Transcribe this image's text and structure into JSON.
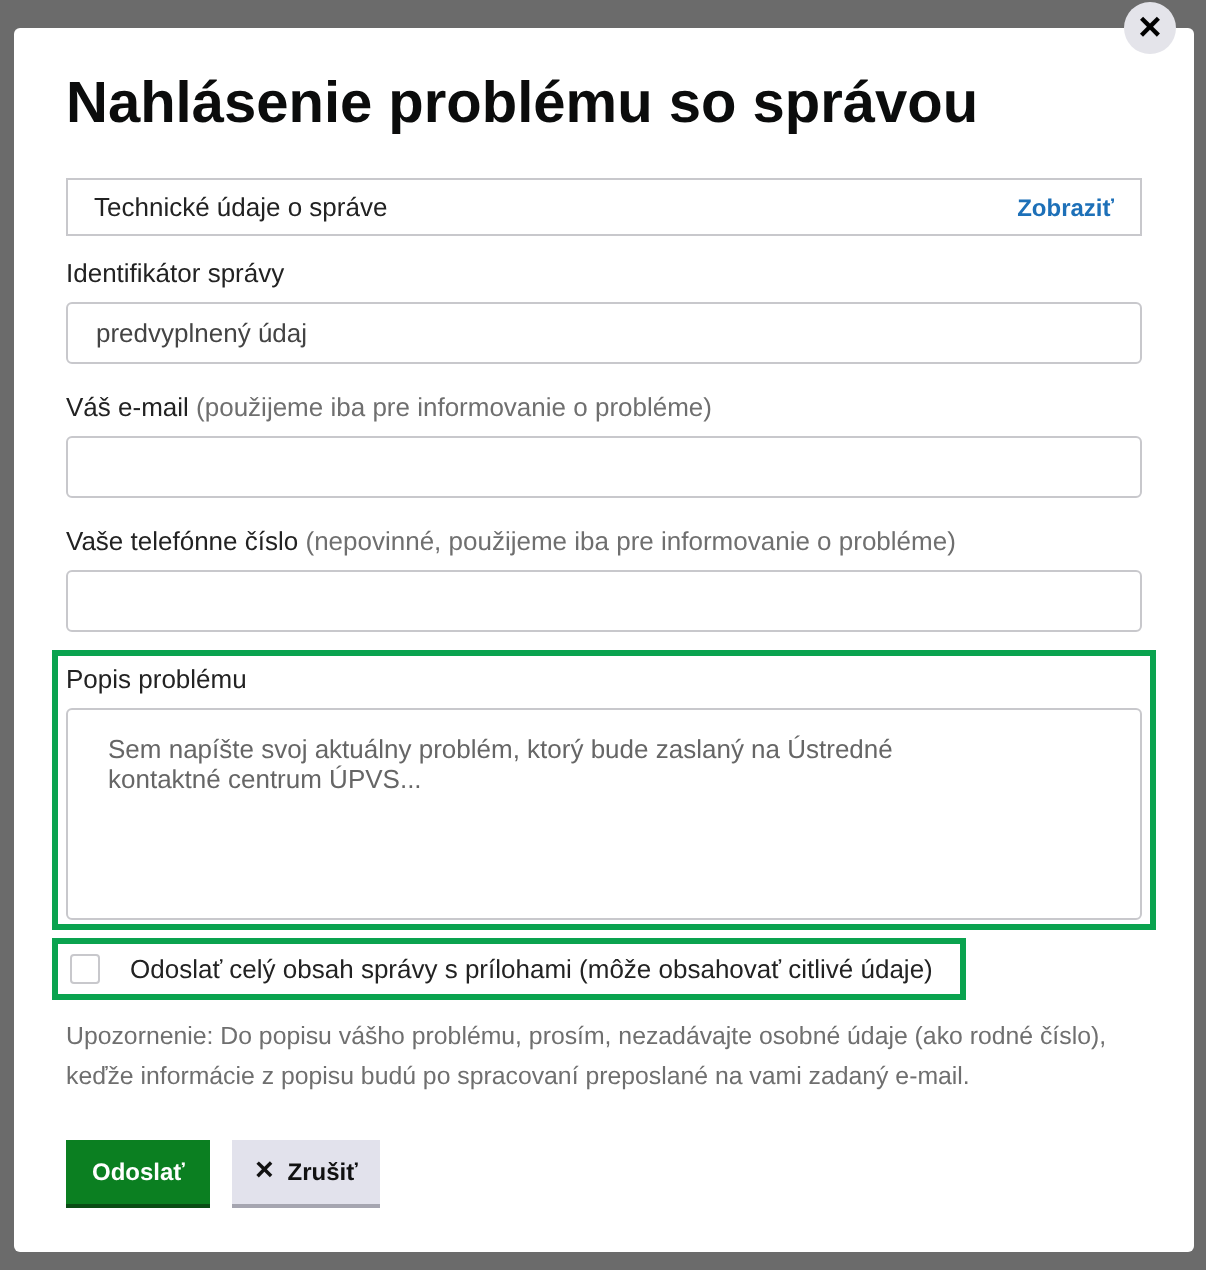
{
  "dialog": {
    "title": "Nahlásenie problému so správou",
    "close": "×"
  },
  "technical": {
    "label": "Technické údaje o správe",
    "link": "Zobraziť"
  },
  "fields": [
    {
      "kind": "input",
      "label": "Identifikátor správy",
      "value": "predvyplnený údaj",
      "highlighted": false
    },
    {
      "kind": "input",
      "label": "Váš e-mail",
      "note": "(použijeme iba pre informovanie o probléme)",
      "highlighted": false
    },
    {
      "kind": "input",
      "label": "Vaše telefónne číslo",
      "note": "(nepovinné, použijeme iba pre informovanie o probléme)",
      "highlighted": false
    },
    {
      "kind": "textarea",
      "label": "Popis problému",
      "placeholder": "Sem napíšte svoj aktuálny problém, ktorý bude zaslaný na Ústredné kontaktné centrum ÚPVS...",
      "highlighted": true
    }
  ],
  "attach": {
    "label": "Odoslať celý obsah správy s prílohami (môže obsahovať citlivé údaje)",
    "checked": false,
    "highlighted": true
  },
  "warning": "Upozornenie: Do popisu vášho problému, prosím, nezadávajte osobné údaje (ako rodné číslo), keďže informácie z popisu budú po spracovaní preposlané na vami zadaný e-mail.",
  "buttons": [
    {
      "kind": "primary",
      "label": "Odoslať"
    },
    {
      "kind": "cancel",
      "icon": "×",
      "label": "Zrušiť"
    }
  ]
}
